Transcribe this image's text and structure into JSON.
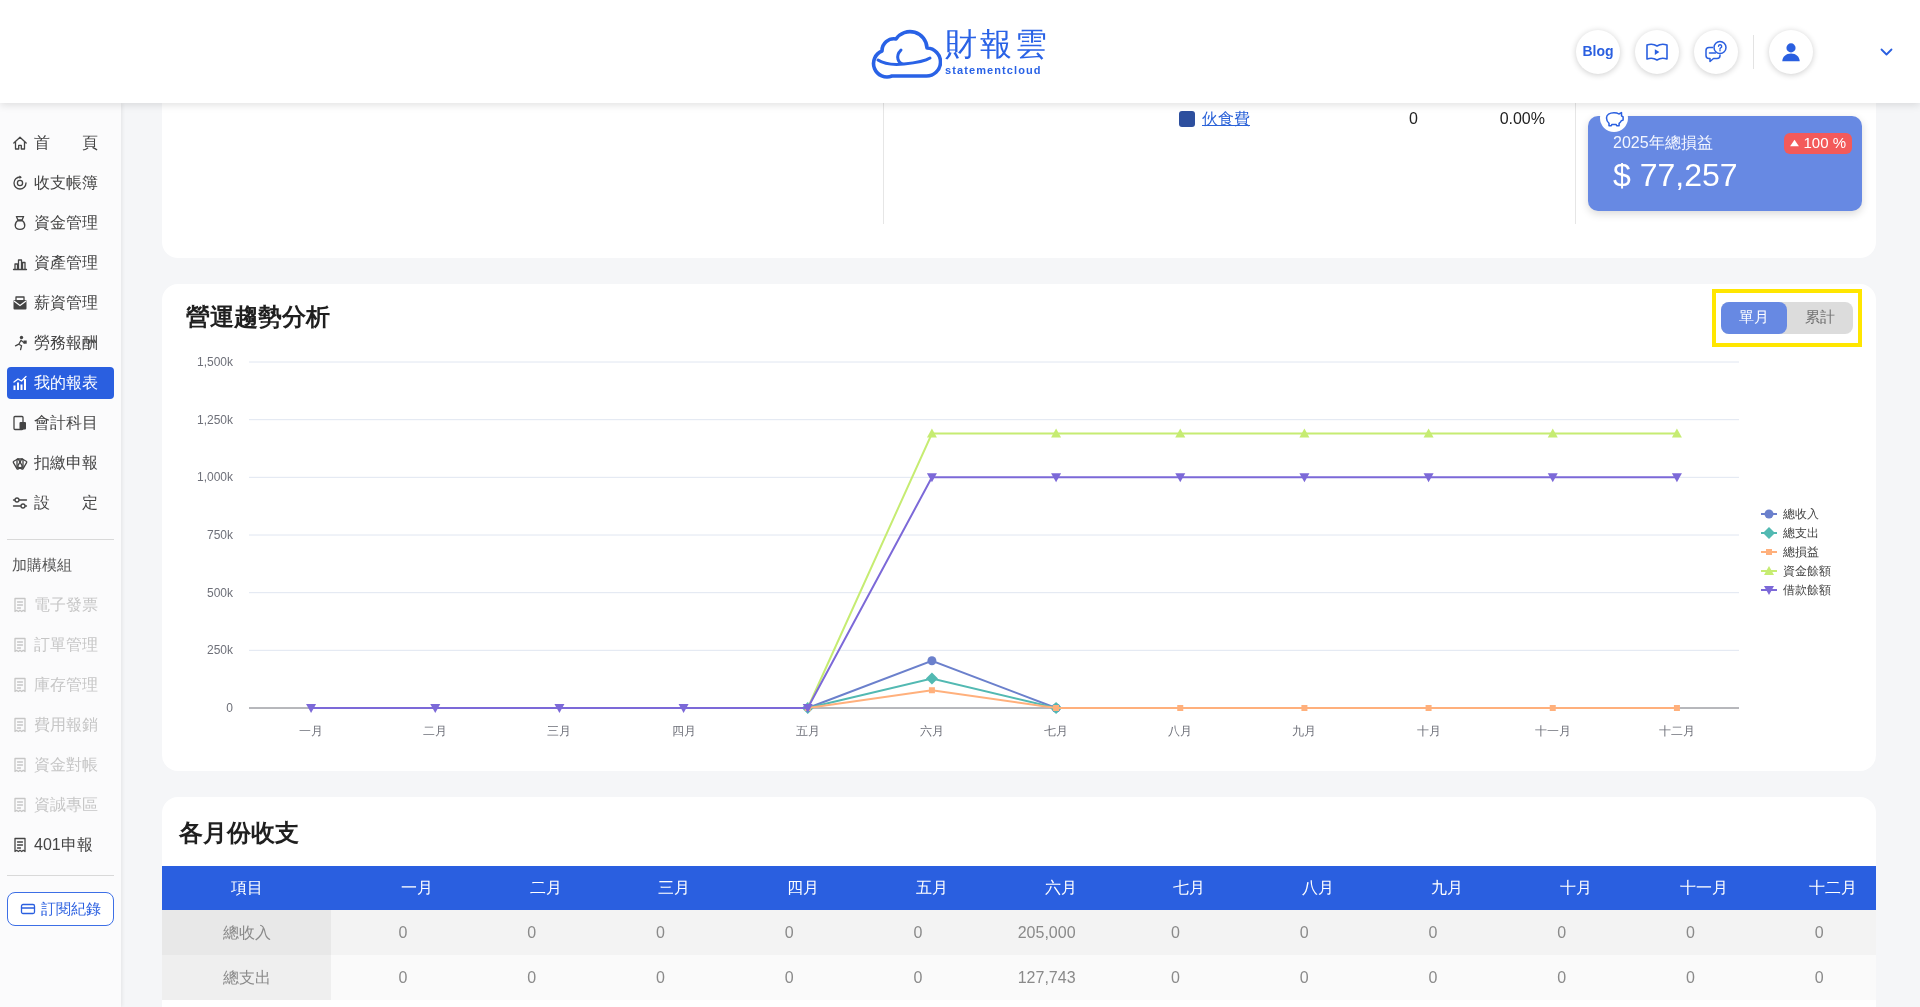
{
  "header": {
    "logo_title": "財報雲",
    "logo_subtitle": "statementcloud",
    "blog_button": "Blog",
    "user_menu": {
      "expanded": false
    }
  },
  "sidebar": {
    "items": [
      {
        "label": "首　　頁",
        "selected": false
      },
      {
        "label": "收支帳簿",
        "selected": false
      },
      {
        "label": "資金管理",
        "selected": false
      },
      {
        "label": "資產管理",
        "selected": false
      },
      {
        "label": "薪資管理",
        "selected": false
      },
      {
        "label": "勞務報酬",
        "selected": false
      },
      {
        "label": "我的報表",
        "selected": true
      },
      {
        "label": "會計科目",
        "selected": false
      },
      {
        "label": "扣繳申報",
        "selected": false
      },
      {
        "label": "設　　定",
        "selected": false
      }
    ],
    "modules_heading": "加購模組",
    "modules": [
      {
        "label": "電子發票",
        "disabled": true
      },
      {
        "label": "訂單管理",
        "disabled": true
      },
      {
        "label": "庫存管理",
        "disabled": true
      },
      {
        "label": "費用報銷",
        "disabled": true
      },
      {
        "label": "資金對帳",
        "disabled": true
      },
      {
        "label": "資誠專區",
        "disabled": true
      },
      {
        "label": "401申報",
        "disabled": false
      }
    ],
    "subscription_button": "訂閱紀錄"
  },
  "summary": {
    "legend_rows": [
      {
        "color": "#2d4f9e",
        "label": "伙食費",
        "amount": "0",
        "percent": "0.00%"
      }
    ],
    "profit_card": {
      "title": "2025年總損益",
      "value": "$ 77,257",
      "change": {
        "rising": true,
        "text": "100 %"
      }
    }
  },
  "trend_section": {
    "title": "營運趨勢分析",
    "toggle": {
      "highlighted": true,
      "options": [
        {
          "label": "單月",
          "selected": true
        },
        {
          "label": "累計",
          "selected": false
        }
      ]
    },
    "chart_data": {
      "type": "line",
      "grid": true,
      "legend": true,
      "categories": [
        "一月",
        "二月",
        "三月",
        "四月",
        "五月",
        "六月",
        "七月",
        "八月",
        "九月",
        "十月",
        "十一月",
        "十二月"
      ],
      "ylim": [
        0,
        1500000
      ],
      "yticks": [
        {
          "value": 0,
          "label": "0"
        },
        {
          "value": 250000,
          "label": "250k"
        },
        {
          "value": 500000,
          "label": "500k"
        },
        {
          "value": 750000,
          "label": "750k"
        },
        {
          "value": 1000000,
          "label": "1,000k"
        },
        {
          "value": 1250000,
          "label": "1,250k"
        },
        {
          "value": 1500000,
          "label": "1,500k"
        }
      ],
      "series": [
        {
          "name": "總收入",
          "color": "#6b80cc",
          "marker": "circle",
          "values": [
            null,
            null,
            null,
            null,
            0,
            205000,
            0,
            null,
            null,
            null,
            null,
            null
          ]
        },
        {
          "name": "總支出",
          "color": "#52b9b2",
          "marker": "diamond",
          "values": [
            null,
            null,
            null,
            null,
            0,
            128000,
            0,
            null,
            null,
            null,
            null,
            null
          ]
        },
        {
          "name": "總損益",
          "color": "#ffb07c",
          "marker": "square",
          "values": [
            null,
            null,
            null,
            null,
            0,
            77000,
            0,
            0,
            0,
            0,
            0,
            0
          ]
        },
        {
          "name": "資金餘額",
          "color": "#c6ec72",
          "marker": "triangle",
          "values": [
            null,
            null,
            null,
            null,
            0,
            1190000,
            1190000,
            1190000,
            1190000,
            1190000,
            1190000,
            1190000
          ]
        },
        {
          "name": "借款餘額",
          "color": "#7c69d8",
          "marker": "triangle-down",
          "values": [
            0,
            0,
            0,
            0,
            0,
            1000000,
            1000000,
            1000000,
            1000000,
            1000000,
            1000000,
            1000000
          ]
        }
      ]
    }
  },
  "monthly_table": {
    "title": "各月份收支",
    "columns": [
      "項目",
      "一月",
      "二月",
      "三月",
      "四月",
      "五月",
      "六月",
      "七月",
      "八月",
      "九月",
      "十月",
      "十一月",
      "十二月"
    ],
    "rows": [
      {
        "cells": [
          "總收入",
          "0",
          "0",
          "0",
          "0",
          "0",
          "205,000",
          "0",
          "0",
          "0",
          "0",
          "0",
          "0"
        ]
      },
      {
        "cells": [
          "總支出",
          "0",
          "0",
          "0",
          "0",
          "0",
          "127,743",
          "0",
          "0",
          "0",
          "0",
          "0",
          "0"
        ]
      }
    ]
  }
}
